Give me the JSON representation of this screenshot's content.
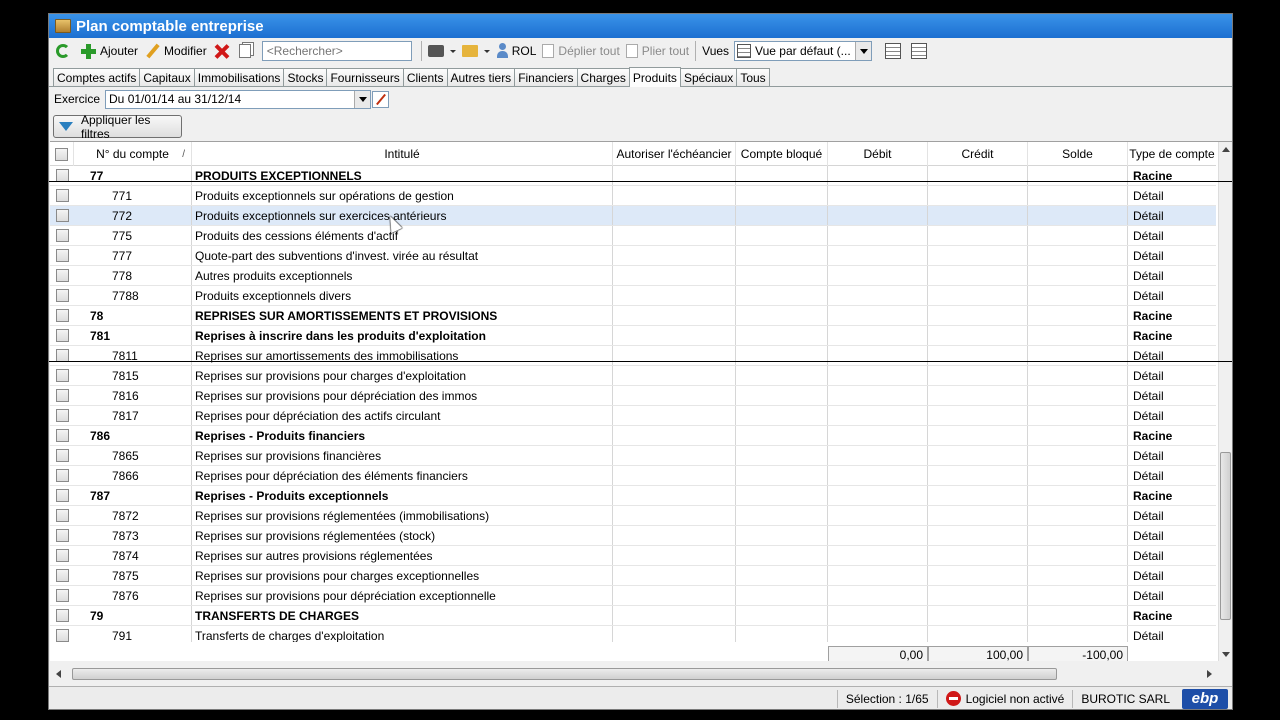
{
  "window": {
    "title": "Plan comptable entreprise"
  },
  "toolbar": {
    "add_label": "Ajouter",
    "modify_label": "Modifier",
    "search_placeholder": "<Rechercher>",
    "rol_label": "ROL",
    "expand_all_label": "Déplier tout",
    "collapse_all_label": "Plier tout",
    "views_label": "Vues",
    "view_value": "Vue par défaut (..."
  },
  "tabs": [
    {
      "label": "Comptes actifs"
    },
    {
      "label": "Capitaux"
    },
    {
      "label": "Immobilisations"
    },
    {
      "label": "Stocks"
    },
    {
      "label": "Fournisseurs"
    },
    {
      "label": "Clients"
    },
    {
      "label": "Autres tiers"
    },
    {
      "label": "Financiers"
    },
    {
      "label": "Charges"
    },
    {
      "label": "Produits",
      "active": true
    },
    {
      "label": "Spéciaux"
    },
    {
      "label": "Tous"
    }
  ],
  "exercice": {
    "label": "Exercice",
    "value": "Du 01/01/14 au 31/12/14"
  },
  "filters": {
    "apply_label": "Appliquer les filtres"
  },
  "grid": {
    "columns": {
      "numero": "N° du compte",
      "sort_indicator": "/",
      "intitule": "Intitulé",
      "echeancier": "Autoriser l'échéancier",
      "bloque": "Compte bloqué",
      "debit": "Débit",
      "credit": "Crédit",
      "solde": "Solde",
      "type": "Type de compte"
    },
    "rows": [
      {
        "num": "77",
        "label": "PRODUITS EXCEPTIONNELS",
        "type": "Racine",
        "racine": true
      },
      {
        "num": "771",
        "label": "Produits exceptionnels sur opérations de gestion",
        "type": "Détail"
      },
      {
        "num": "772",
        "label": "Produits exceptionnels sur exercices antérieurs",
        "type": "Détail",
        "selected": true
      },
      {
        "num": "775",
        "label": "Produits des cessions éléments d'actif",
        "type": "Détail"
      },
      {
        "num": "777",
        "label": "Quote-part des subventions d'invest. virée au résultat",
        "type": "Détail"
      },
      {
        "num": "778",
        "label": "Autres produits exceptionnels",
        "type": "Détail"
      },
      {
        "num": "7788",
        "label": "Produits exceptionnels divers",
        "type": "Détail"
      },
      {
        "num": "78",
        "label": "REPRISES SUR AMORTISSEMENTS ET PROVISIONS",
        "type": "Racine",
        "racine": true
      },
      {
        "num": "781",
        "label": "Reprises à inscrire dans les produits d'exploitation",
        "type": "Racine",
        "racine": true
      },
      {
        "num": "7811",
        "label": "Reprises sur amortissements des immobilisations",
        "type": "Détail"
      },
      {
        "num": "7815",
        "label": "Reprises sur provisions pour charges d'exploitation",
        "type": "Détail"
      },
      {
        "num": "7816",
        "label": "Reprises sur provisions pour dépréciation des immos",
        "type": "Détail"
      },
      {
        "num": "7817",
        "label": "Reprises pour dépréciation des actifs circulant",
        "type": "Détail"
      },
      {
        "num": "786",
        "label": "Reprises - Produits financiers",
        "type": "Racine",
        "racine": true
      },
      {
        "num": "7865",
        "label": "Reprises sur provisions financières",
        "type": "Détail"
      },
      {
        "num": "7866",
        "label": "Reprises pour dépréciation des éléments financiers",
        "type": "Détail"
      },
      {
        "num": "787",
        "label": "Reprises - Produits exceptionnels",
        "type": "Racine",
        "racine": true
      },
      {
        "num": "7872",
        "label": "Reprises sur provisions réglementées (immobilisations)",
        "type": "Détail"
      },
      {
        "num": "7873",
        "label": "Reprises sur provisions réglementées (stock)",
        "type": "Détail"
      },
      {
        "num": "7874",
        "label": "Reprises sur autres provisions réglementées",
        "type": "Détail"
      },
      {
        "num": "7875",
        "label": "Reprises sur provisions pour charges exceptionnelles",
        "type": "Détail"
      },
      {
        "num": "7876",
        "label": "Reprises sur provisions pour dépréciation exceptionnelle",
        "type": "Détail"
      },
      {
        "num": "79",
        "label": "TRANSFERTS DE CHARGES",
        "type": "Racine",
        "racine": true
      },
      {
        "num": "791",
        "label": "Transferts de charges d'exploitation",
        "type": "Détail"
      }
    ],
    "totals": {
      "debit": "0,00",
      "credit": "100,00",
      "solde": "-100,00"
    }
  },
  "status": {
    "selection": "Sélection : 1/65",
    "license": "Logiciel non activé",
    "company": "BUROTIC SARL",
    "logo": "ebp"
  }
}
